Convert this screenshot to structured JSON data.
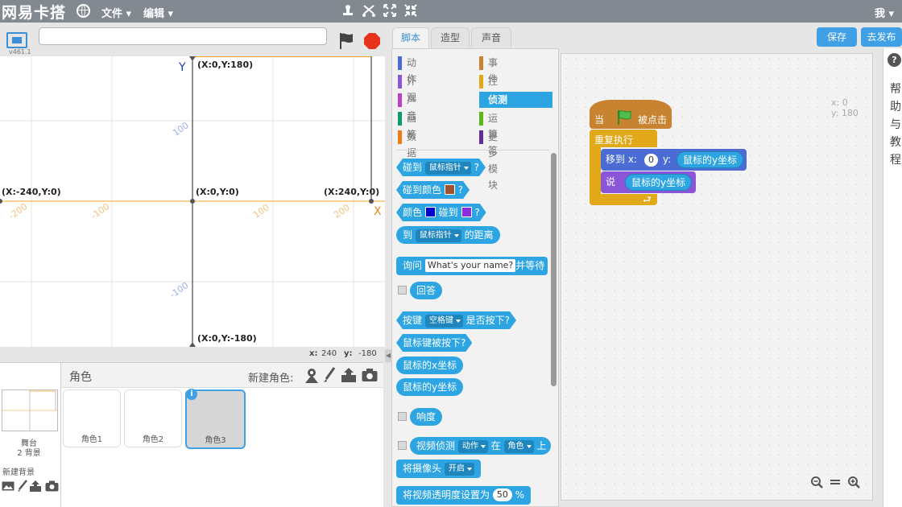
{
  "app": {
    "title": "网易卡搭",
    "user": "我"
  },
  "menu": {
    "file": "文件",
    "edit": "编辑"
  },
  "toolbar": {
    "duplicate": "⛊",
    "cut": "✂",
    "grow": "⤢",
    "shrink": "⤡"
  },
  "stage": {
    "version": "v461.1",
    "project_name": "",
    "labels": {
      "top": "(X:0,Y:180)",
      "left": "(X:-240,Y:0)",
      "center": "(X:0,Y:0)",
      "right": "(X:240,Y:0)",
      "bottom": "(X:0,Y:-180)",
      "y_axis": "Y",
      "x_axis": "X",
      "tick_y_100": "100",
      "tick_y_m100": "-100",
      "tick_x_m200": "-200",
      "tick_x_m100": "-100",
      "tick_x_100": "100",
      "tick_x_200": "200"
    },
    "mouse_x_label": "x:",
    "mouse_x": "240",
    "mouse_y_label": "y:",
    "mouse_y": "-180"
  },
  "sprites_panel": {
    "header": "角色",
    "new_sprite": "新建角色:",
    "stage_name": "舞台",
    "stage_backdrops": "2 背景",
    "new_backdrop": "新建背景",
    "sprites": [
      "角色1",
      "角色2",
      "角色3"
    ],
    "info_badge": "i"
  },
  "tabs": [
    "脚本",
    "造型",
    "声音"
  ],
  "categories": {
    "left": [
      {
        "label": "动作",
        "color": "#4a6cd4"
      },
      {
        "label": "外观",
        "color": "#8a55d7"
      },
      {
        "label": "声音",
        "color": "#bb42c3"
      },
      {
        "label": "画笔",
        "color": "#0e9a6c"
      },
      {
        "label": "数据",
        "color": "#ee7d16"
      }
    ],
    "right": [
      {
        "label": "事件",
        "color": "#c88330"
      },
      {
        "label": "控制",
        "color": "#e1a91a"
      },
      {
        "label": "侦测",
        "color": "#2ca5e2"
      },
      {
        "label": "运算符",
        "color": "#5cb712"
      },
      {
        "label": "更多模块",
        "color": "#632d99"
      }
    ],
    "selected": "侦测"
  },
  "blocks": {
    "touching": "碰到",
    "touching_opt": "鼠标指针",
    "q": "?",
    "touching_color": "碰到颜色",
    "color_a": "#a0522d",
    "color_label": "颜色",
    "color_b": "#0000cc",
    "touching2": "碰到",
    "color_c": "#8a2be2",
    "to": "到",
    "to_opt": "鼠标指针",
    "distance": "的距离",
    "ask": "询问",
    "ask_default": "What's your name?",
    "and_wait": "并等待",
    "answer": "回答",
    "key": "按键",
    "key_opt": "空格键",
    "key_pressed": "是否按下?",
    "mouse_down": "鼠标键被按下?",
    "mouse_x": "鼠标的x坐标",
    "mouse_y": "鼠标的y坐标",
    "loudness": "响度",
    "video": "视频侦测",
    "video_opt1": "动作",
    "video_on": "在",
    "video_opt2": "角色",
    "video_up": "上",
    "camera": "将摄像头",
    "camera_opt": "开启",
    "transparency": "将视频透明度设置为",
    "transparency_val": "50",
    "percent": "%"
  },
  "script": {
    "when": "当",
    "clicked": "被点击",
    "forever": "重复执行",
    "goto": "移到 x:",
    "goto_x": "0",
    "goto_y": "y:",
    "goto_y_reporter": "鼠标的y坐标",
    "say": "说",
    "say_reporter": "鼠标的y坐标",
    "coord_x": "x: 0",
    "coord_y": "y: 180"
  },
  "buttons": {
    "save": "保存",
    "publish": "去发布"
  },
  "help": {
    "icon": "?",
    "text": "帮助与教程"
  }
}
